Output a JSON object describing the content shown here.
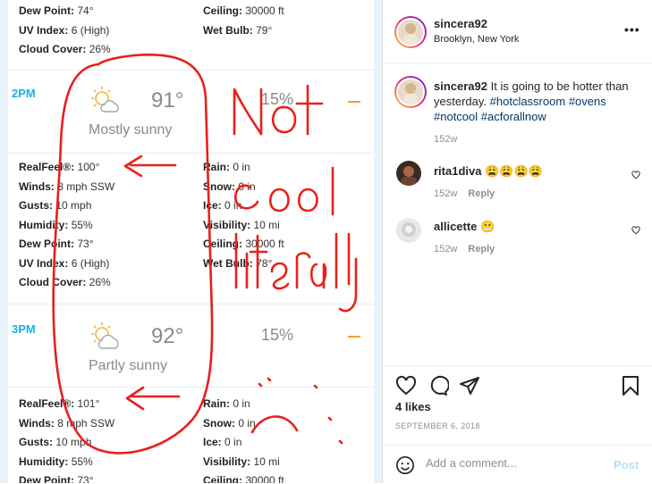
{
  "weather": {
    "top_block": {
      "left": [
        {
          "label": "Dew Point:",
          "value": "74°"
        },
        {
          "label": "UV Index:",
          "value": "6 (High)"
        },
        {
          "label": "Cloud Cover:",
          "value": "26%"
        }
      ],
      "right": [
        {
          "label": "Ceiling:",
          "value": "30000 ft"
        },
        {
          "label": "Wet Bulb:",
          "value": "79°"
        }
      ]
    },
    "hours": [
      {
        "time": "2PM",
        "temp": "91°",
        "condition": "Mostly sunny",
        "precip": "15%",
        "left": [
          {
            "label": "RealFeel®:",
            "value": "100°"
          },
          {
            "label": "Winds:",
            "value": "8 mph SSW"
          },
          {
            "label": "Gusts:",
            "value": "10 mph"
          },
          {
            "label": "Humidity:",
            "value": "55%"
          },
          {
            "label": "Dew Point:",
            "value": "73°"
          },
          {
            "label": "UV Index:",
            "value": "6 (High)"
          },
          {
            "label": "Cloud Cover:",
            "value": "26%"
          }
        ],
        "right": [
          {
            "label": "Rain:",
            "value": "0 in"
          },
          {
            "label": "Snow:",
            "value": "0 in"
          },
          {
            "label": "Ice:",
            "value": "0 in"
          },
          {
            "label": "Visibility:",
            "value": "10 mi"
          },
          {
            "label": "Ceiling:",
            "value": "30000 ft"
          },
          {
            "label": "Wet Bulb:",
            "value": "78°"
          }
        ]
      },
      {
        "time": "3PM",
        "temp": "92°",
        "condition": "Partly sunny",
        "precip": "15%",
        "left": [
          {
            "label": "RealFeel®:",
            "value": "101°"
          },
          {
            "label": "Winds:",
            "value": "8 mph SSW"
          },
          {
            "label": "Gusts:",
            "value": "10 mph"
          },
          {
            "label": "Humidity:",
            "value": "55%"
          },
          {
            "label": "Dew Point:",
            "value": "73°"
          }
        ],
        "right": [
          {
            "label": "Rain:",
            "value": "0 in"
          },
          {
            "label": "Snow:",
            "value": "0 in"
          },
          {
            "label": "Ice:",
            "value": "0 in"
          },
          {
            "label": "Visibility:",
            "value": "10 mi"
          },
          {
            "label": "Ceiling:",
            "value": "30000 ft"
          }
        ]
      }
    ],
    "scribble_text": [
      "Not",
      "cool",
      "literally"
    ]
  },
  "post": {
    "username": "sincera92",
    "location": "Brooklyn, New York",
    "more": "•••",
    "caption_text": "It is going to be hotter than yesterday.",
    "hashtags": [
      "#hotclassroom",
      "#ovens",
      "#notcool",
      "#acforallnow"
    ],
    "caption_age": "152w",
    "comments": [
      {
        "user": "rita1diva",
        "text": "😩😩😩😩",
        "age": "152w",
        "reply": "Reply"
      },
      {
        "user": "allicette",
        "text": "😬",
        "age": "152w",
        "reply": "Reply"
      }
    ],
    "likes": "4 likes",
    "date": "SEPTEMBER 6, 2018",
    "comment_placeholder": "Add a comment...",
    "post_label": "Post",
    "colors": {
      "link": "#00376b",
      "post_disabled": "#b2dffc",
      "hour_label": "#1ab1e6",
      "scribble": "#e8201a"
    }
  }
}
